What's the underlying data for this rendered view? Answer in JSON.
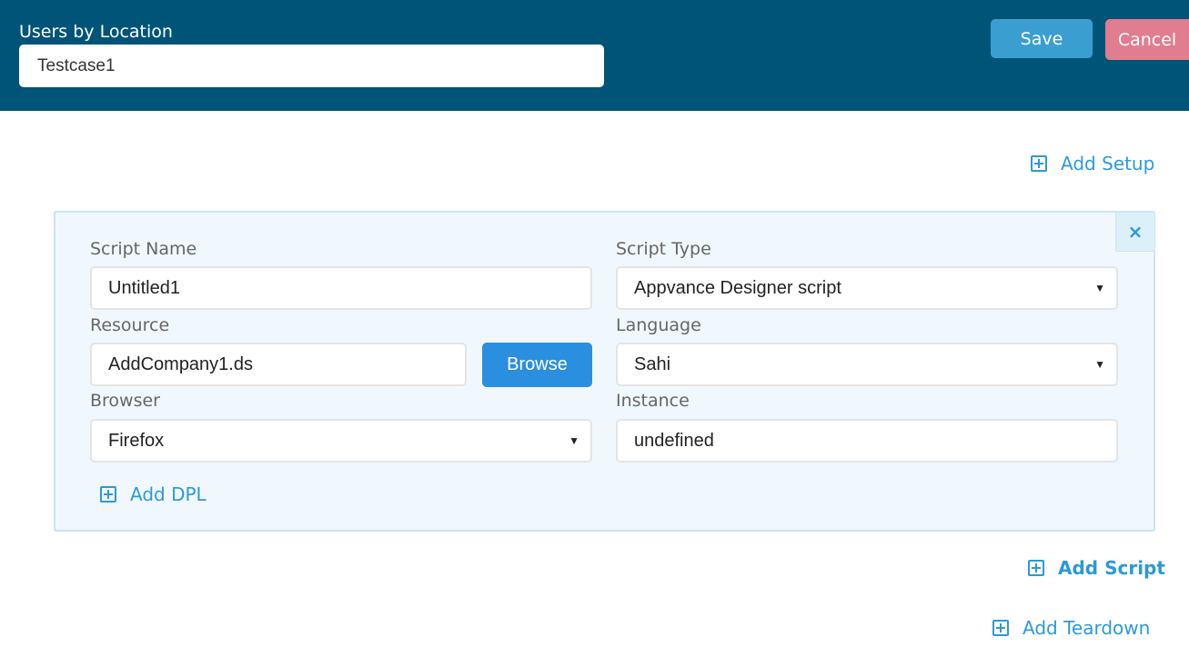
{
  "header": {
    "title": "Users by Location",
    "testcase_name": "Testcase1",
    "save_label": "Save",
    "cancel_label": "Cancel"
  },
  "actions": {
    "add_setup": "Add Setup",
    "add_script": "Add Script",
    "add_teardown": "Add Teardown"
  },
  "script": {
    "close_glyph": "×",
    "script_name": {
      "label": "Script Name",
      "value": "Untitled1"
    },
    "script_type": {
      "label": "Script Type",
      "value": "Appvance Designer script"
    },
    "resource": {
      "label": "Resource",
      "value": "AddCompany1.ds",
      "browse_label": "Browse"
    },
    "language": {
      "label": "Language",
      "value": "Sahi"
    },
    "browser": {
      "label": "Browser",
      "value": "Firefox"
    },
    "instance": {
      "label": "Instance",
      "value": "undefined"
    },
    "add_dpl": "Add DPL"
  },
  "colors": {
    "header_bg": "#005477",
    "save": "#3a9fd0",
    "cancel": "#e07d8f",
    "accent": "#2c99d6",
    "browse": "#2b8fe0",
    "panel_bg": "#f1f8fd"
  },
  "icons": {
    "plus": "plus-square-icon",
    "close": "close-icon",
    "dropdown": "caret-down-icon"
  }
}
